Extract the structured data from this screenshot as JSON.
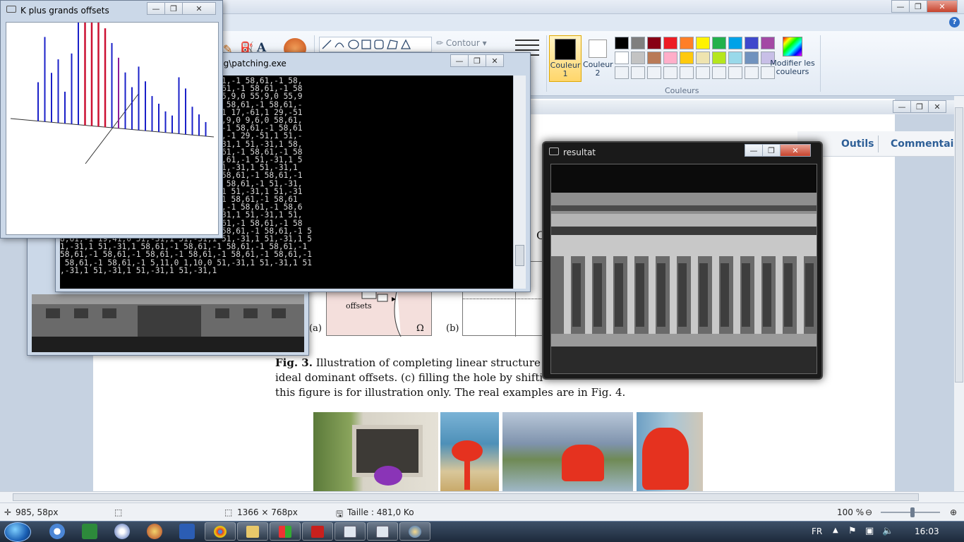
{
  "paint": {
    "ribbon": {
      "contour_label": "Contour",
      "color1_label_a": "Couleur",
      "color1_label_b": "1",
      "color2_label_a": "Couleur",
      "color2_label_b": "2",
      "colors_group_label": "Couleurs",
      "edit_colors_label_a": "Modifier les",
      "edit_colors_label_b": "couleurs",
      "help_glyph": "?",
      "palette_row1": [
        "#000000",
        "#7f7f7f",
        "#880015",
        "#ed1c24",
        "#ff7f27",
        "#fff200",
        "#22b14c",
        "#00a2e8",
        "#3f48cc",
        "#a349a4"
      ],
      "palette_row2": [
        "#ffffff",
        "#c3c3c3",
        "#b97a57",
        "#ffaec9",
        "#ffc90e",
        "#efe4b0",
        "#b5e61d",
        "#99d9ea",
        "#7092be",
        "#c8bfe7"
      ]
    },
    "statusbar": {
      "cursor_pos": "985, 58px",
      "image_size": "1366 × 768px",
      "file_size": "Taille : 481,0 Ko",
      "zoom": "100 %"
    }
  },
  "reader": {
    "toolbar_tools": "Outils",
    "toolbar_comment": "Commentair",
    "caption_line1_bold": "Fig. 3.",
    "caption_line1": "Illustration of completing linear structure",
    "caption_line2": "ideal dominant offsets. (c) filling the hole by shifti",
    "caption_line3": "this figure is for illustration only. The real examples are in Fig. 4.",
    "label_a": "(a)",
    "label_b": "(b)",
    "label_offsets": "offsets",
    "label_omega": "Ω",
    "peek_char": "C"
  },
  "offsets_window": {
    "title": "K plus grands offsets"
  },
  "console_window": {
    "title": "ug\\patching.exe",
    "lines": [
      ",0 58,61,-1 58,61,-1 58,61,-1 58,61,-1 58,61,-1 58,",
      ",-1 58,61,-1 58,61,-1 58,61,-1 58,61,-1 58,61,-1 58",
      "27,0 1,10,0 1,10,0 55,9,0 55,9,0 55,9,0 55,9,0 55,9",
      "8,61,-1 58,61,-1 58,61,-1 58,61,-1 58,61,-1 58,61,-",
      "58,61,-1 58,61,-1 58,61,-1 58,61,-1 17,-61,1 29,-51",
      " 51,-31,1 28,31,0 55,9,0 55,9,0 55,9,0 9,6,0 58,61,",
      " 58,61,-1 58,61,-1 58,61,-1 58,61,-1 58,61,-1 58,61",
      "1 58,61,-1 58,61,-1 58,61,-1 58,61,-1 29,-51,1 51,-",
      ",1 51,-31,1 51,-31,1 51,-31,1 51,-31,1 51,-31,1 58,",
      ",-1 58,61,-1 58,61,-1 58,61,-1 58,61,-1 58,61,-1 58",
      "1,-1 58,61,-1 58,61,-1 58,61,-1 58,61,-1 51,-31,1 5",
      "-31,1 51,-31,1 51,-31,1 51,-31,1 51,-31,1 51,-31,1 ",
      ",61,-1 58,61,-1 58,61,-1 58,61,-1 58,61,-1 58,61,-1",
      "8,61,-1 58,61,-1 58,61,-1 58,61,-1 58,61,-1 51,-31,",
      "51,-31,1 51,-31,1 51,-31,1 51,-31,1 51,-31,1 51,-31",
      "58,61,-1 58,61,-1 58,61,-1 58,61,-1 58,61,-1 58,61",
      "1 58,61,-1 58,61,-1 58,61,-1 58,61,-1 58,61,-1 58,6",
      ",1 51,-31,1 51,-31,1 51,-31,1 51,-31,1 51,-31,1 51,",
      ",-1 58,61,-1 58,61,-1 58,61,-1 58,61,-1 58,61,-1 58",
      ",61,-1 58,61,-1 58,61,-1 58,61,-1 58,61,-1 58,61,-1 5",
      "8,61,-1 19,41,0 51,-31,1 51,-31,1 51,-31,1 51,-31,1 5",
      "1,-31,1 51,-31,1 58,61,-1 58,61,-1 58,61,-1 58,61,-1",
      "58,61,-1 58,61,-1 58,61,-1 58,61,-1 58,61,-1 58,61,-1",
      " 58,61,-1 58,61,-1 5,11,0 1,10,0 51,-31,1 51,-31,1 51",
      ",-31,1 51,-31,1 51,-31,1 51,-31,1"
    ]
  },
  "resultat_window": {
    "title": "resultat"
  },
  "taskbar": {
    "lang": "FR",
    "time": "16:03"
  },
  "chart_data": {
    "type": "bar",
    "series_heights": [
      55,
      120,
      70,
      90,
      45,
      100,
      160,
      150,
      150,
      150,
      140,
      120,
      100,
      80,
      60,
      90,
      70,
      50,
      40,
      30,
      25,
      80,
      65,
      40,
      30,
      20
    ]
  }
}
